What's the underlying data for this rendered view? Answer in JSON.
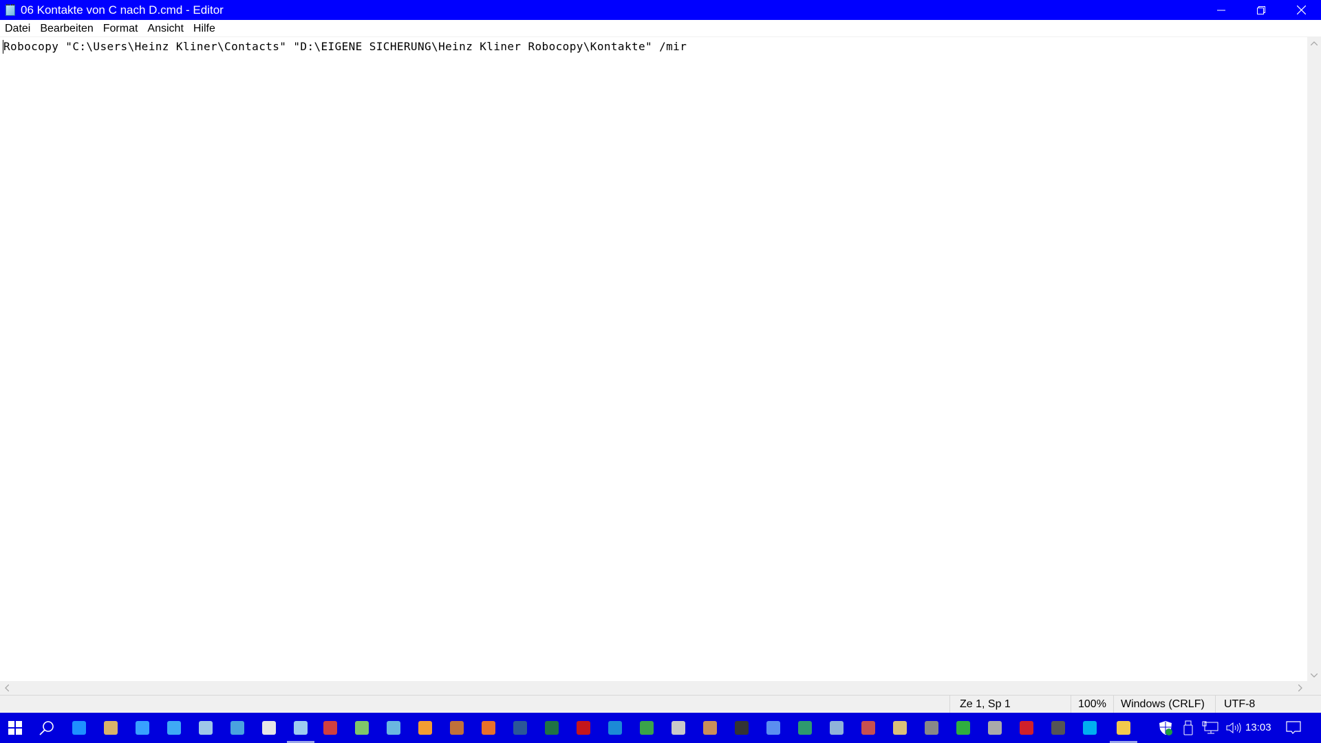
{
  "window": {
    "title": "06 Kontakte von C nach D.cmd - Editor",
    "app_icon": "notepad-icon",
    "controls": {
      "minimize": "minimize-icon",
      "restore": "restore-icon",
      "close": "close-icon"
    }
  },
  "menu": {
    "items": [
      {
        "label": "Datei"
      },
      {
        "label": "Bearbeiten"
      },
      {
        "label": "Format"
      },
      {
        "label": "Ansicht"
      },
      {
        "label": "Hilfe"
      }
    ]
  },
  "editor": {
    "content": "Robocopy \"C:\\Users\\Heinz Kliner\\Contacts\" \"D:\\EIGENE SICHERUNG\\Heinz Kliner Robocopy\\Kontakte\" /mir"
  },
  "statusbar": {
    "position": "Ze 1, Sp 1",
    "zoom": "100%",
    "line_ending": "Windows (CRLF)",
    "encoding": "UTF-8"
  },
  "taskbar": {
    "background": "#0000dd",
    "start": "windows-start-icon",
    "search": "search-icon",
    "apps": [
      {
        "name": "edge-icon",
        "color": "#1e90ff"
      },
      {
        "name": "file-manager-icon",
        "color": "#d9b26a"
      },
      {
        "name": "internet-explorer-icon",
        "color": "#38a0ff"
      },
      {
        "name": "control-panel-icon",
        "color": "#3fa9f5"
      },
      {
        "name": "performance-monitor-icon",
        "color": "#9fc7e8"
      },
      {
        "name": "task-scheduler-icon",
        "color": "#4aa3df"
      },
      {
        "name": "settings-gears-icon",
        "color": "#e6e6e6"
      },
      {
        "name": "notepad-icon",
        "color": "#9ccbf0",
        "active": true
      },
      {
        "name": "toolbox-icon",
        "color": "#d04040"
      },
      {
        "name": "backup-icon",
        "color": "#7fc66a"
      },
      {
        "name": "network-icon",
        "color": "#6ab7e0"
      },
      {
        "name": "media-player-icon",
        "color": "#f39c32"
      },
      {
        "name": "video-editor-icon",
        "color": "#c0703a"
      },
      {
        "name": "photo-app-icon",
        "color": "#e8702a"
      },
      {
        "name": "word-icon",
        "color": "#2b5797"
      },
      {
        "name": "excel-icon",
        "color": "#1f7244"
      },
      {
        "name": "acrobat-icon",
        "color": "#c4161c"
      },
      {
        "name": "photoshop-elements-icon",
        "color": "#1c8ad6"
      },
      {
        "name": "checkmark-app-icon",
        "color": "#3aa34a"
      },
      {
        "name": "scanner-icon",
        "color": "#c9c9c9"
      },
      {
        "name": "user-account-icon",
        "color": "#c98f5a"
      },
      {
        "name": "game-controller-icon",
        "color": "#333333"
      },
      {
        "name": "samsung-icon",
        "color": "#5b8ef0"
      },
      {
        "name": "font-app-icon",
        "color": "#2e9a6e"
      },
      {
        "name": "magnifier-globe-icon",
        "color": "#8fb3d9"
      },
      {
        "name": "recycle-app-icon",
        "color": "#c75050"
      },
      {
        "name": "image-viewer-icon",
        "color": "#d9c07a"
      },
      {
        "name": "server-check-icon",
        "color": "#888888"
      },
      {
        "name": "green-bug-icon",
        "color": "#2fae3f"
      },
      {
        "name": "disc-icon",
        "color": "#aaaaaa"
      },
      {
        "name": "nero-icon",
        "color": "#d0202a"
      },
      {
        "name": "circle-app-icon",
        "color": "#555555"
      },
      {
        "name": "skype-icon",
        "color": "#00aff0"
      },
      {
        "name": "file-explorer-icon",
        "color": "#f2c94c",
        "active": true
      }
    ],
    "tray": {
      "icons": [
        "windows-defender-icon",
        "usb-device-icon",
        "network-status-icon",
        "volume-icon"
      ],
      "time": "13:03",
      "notifications": "action-center-icon"
    }
  }
}
